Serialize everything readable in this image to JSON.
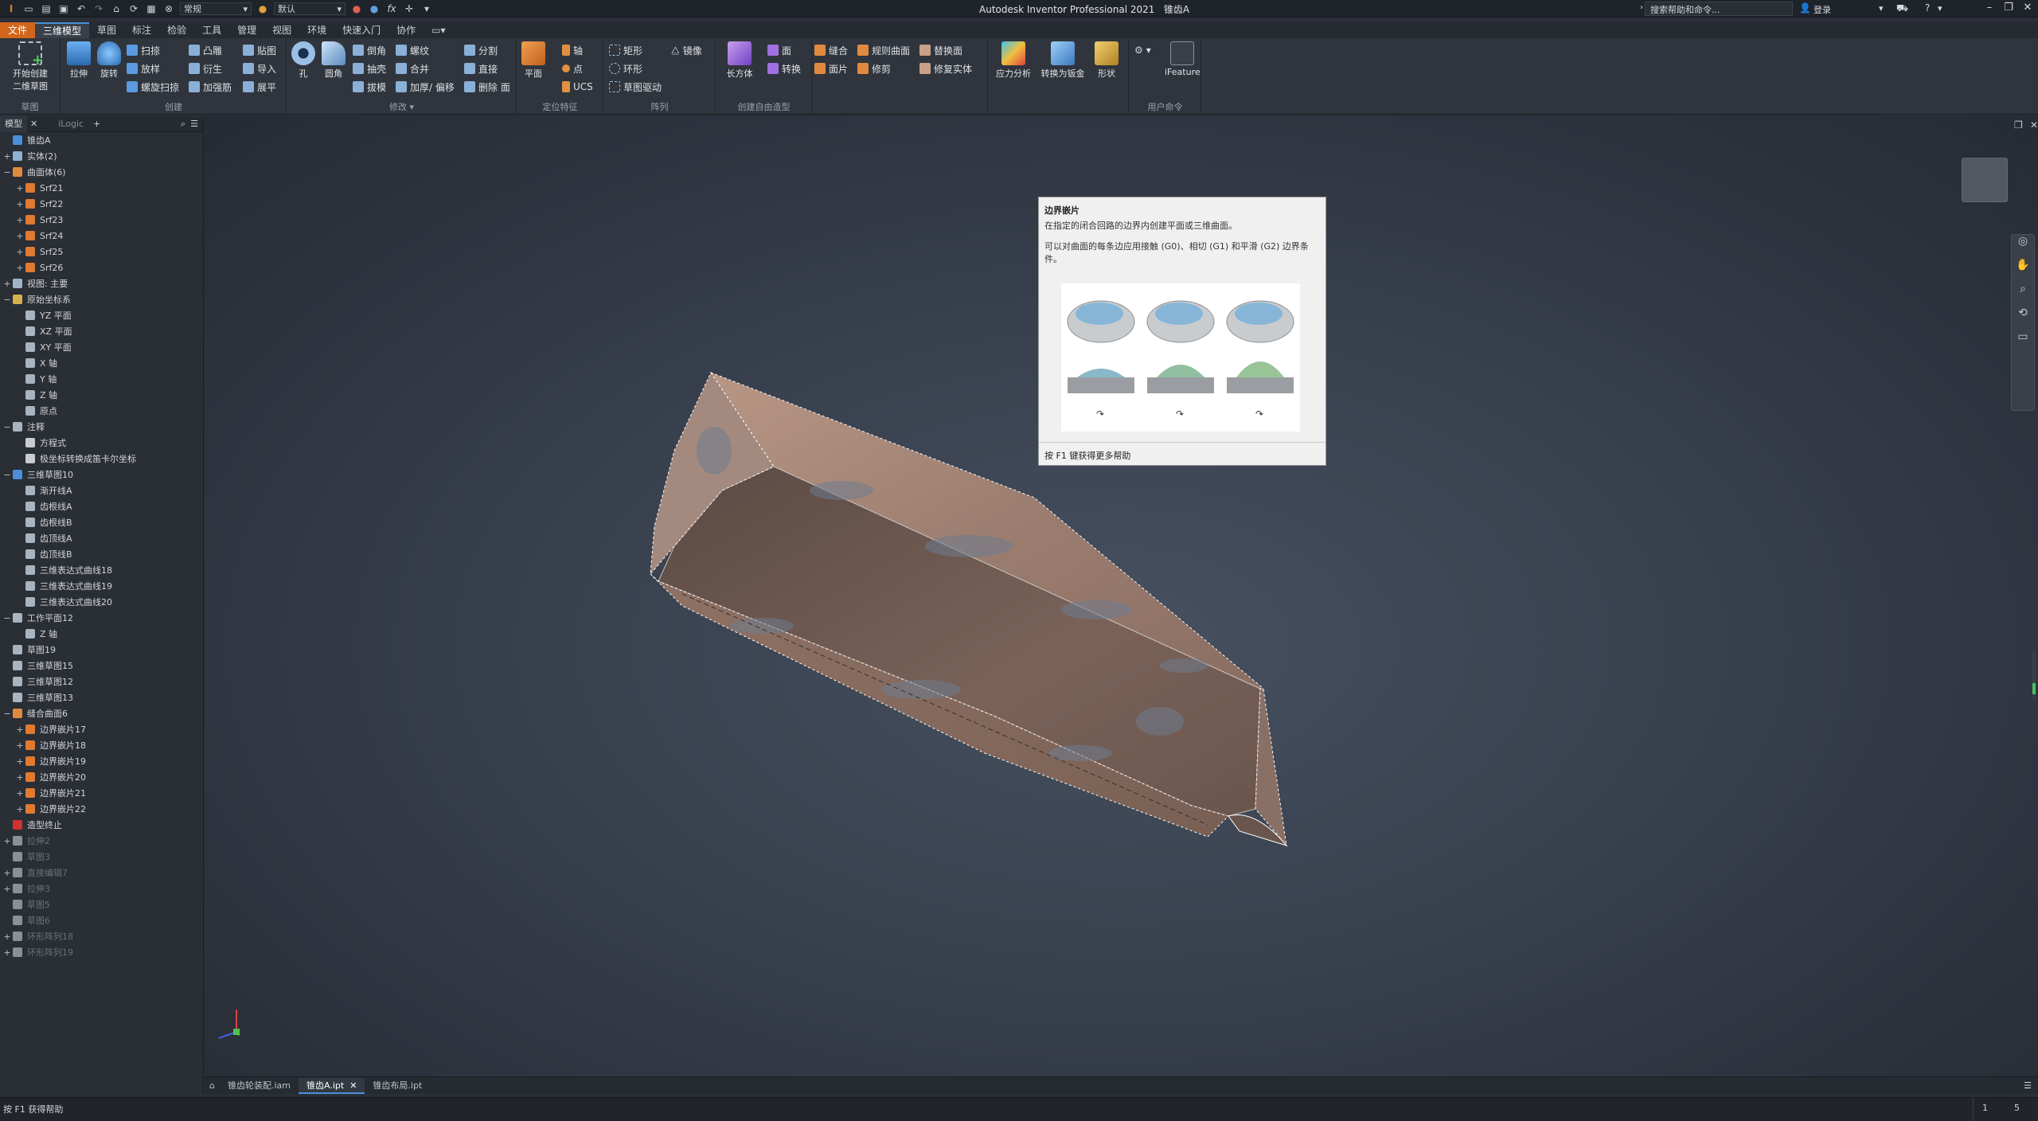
{
  "titlebar": {
    "style_value": "常规",
    "material_value": "默认",
    "fx_label": "fx",
    "app_title": "Autodesk Inventor Professional 2021",
    "doc_title": "锥齿A",
    "search_placeholder": "搜索帮助和命令...",
    "login_label": "登录"
  },
  "menu": {
    "tabs": [
      "文件",
      "三维模型",
      "草图",
      "标注",
      "检验",
      "工具",
      "管理",
      "视图",
      "环境",
      "快速入门",
      "协作"
    ]
  },
  "ribbon": {
    "sketch": {
      "start_label_1": "开始创建",
      "start_label_2": "二维草图",
      "panel": "草图"
    },
    "create": {
      "extrude": "拉伸",
      "revolve": "旋转",
      "sweep": "扫掠",
      "loft": "放样",
      "coil": "螺旋扫掠",
      "emboss": "凸雕",
      "derive": "衍生",
      "rib": "加强筋",
      "decal": "贴图",
      "import": "导入",
      "unwrap": "展平",
      "panel": "创建"
    },
    "modify": {
      "hole": "孔",
      "fillet": "圆角",
      "chamfer": "倒角",
      "shell": "抽壳",
      "draft": "拔模",
      "thread": "螺纹",
      "combine": "合并",
      "thicken": "加厚/ 偏移",
      "split": "分割",
      "direct": "直接",
      "delete_face": "删除 面",
      "panel": "修改 ▾"
    },
    "work": {
      "plane": "平面",
      "axis": "轴",
      "point": "点",
      "ucs": "UCS",
      "panel": "定位特征"
    },
    "pattern": {
      "rect": "矩形",
      "circ": "环形",
      "sketch_driven": "草图驱动",
      "mirror": "镜像",
      "panel": "阵列"
    },
    "freeform": {
      "box": "长方体",
      "face": "面",
      "convert": "转换",
      "panel": "创建自由造型"
    },
    "surface": {
      "stitch": "缝合",
      "ruled": "规则曲面",
      "patch": "面片",
      "trim": "修剪",
      "replace": "替换面",
      "repair": "修复实体"
    },
    "sim": {
      "stress": "应力分析",
      "convert_sm": "转换为钣金",
      "shape": "形状"
    },
    "user": {
      "ifeature": "iFeature",
      "panel": "用户命令"
    }
  },
  "browser": {
    "tab_model": "模型",
    "tab_ilogic": "iLogic",
    "tree": [
      {
        "label": "锥齿A",
        "level": 0,
        "tog": "",
        "icon": "#4a8fd8"
      },
      {
        "label": "实体(2)",
        "level": 0,
        "tog": "+",
        "icon": "#8fb0d0"
      },
      {
        "label": "曲面体(6)",
        "level": 0,
        "tog": "−",
        "icon": "#e08a40"
      },
      {
        "label": "Srf21",
        "level": 1,
        "tog": "+",
        "icon": "#e07a30"
      },
      {
        "label": "Srf22",
        "level": 1,
        "tog": "+",
        "icon": "#e07a30"
      },
      {
        "label": "Srf23",
        "level": 1,
        "tog": "+",
        "icon": "#e07a30"
      },
      {
        "label": "Srf24",
        "level": 1,
        "tog": "+",
        "icon": "#e07a30"
      },
      {
        "label": "Srf25",
        "level": 1,
        "tog": "+",
        "icon": "#e07a30"
      },
      {
        "label": "Srf26",
        "level": 1,
        "tog": "+",
        "icon": "#e07a30"
      },
      {
        "label": "视图: 主要",
        "level": 0,
        "tog": "+",
        "icon": "#a0b4c8"
      },
      {
        "label": "原始坐标系",
        "level": 0,
        "tog": "−",
        "icon": "#d6b050"
      },
      {
        "label": "YZ 平面",
        "level": 1,
        "tog": "",
        "icon": "#a8b4c0"
      },
      {
        "label": "XZ 平面",
        "level": 1,
        "tog": "",
        "icon": "#a8b4c0"
      },
      {
        "label": "XY 平面",
        "level": 1,
        "tog": "",
        "icon": "#a8b4c0"
      },
      {
        "label": "X 轴",
        "level": 1,
        "tog": "",
        "icon": "#a8b4c0"
      },
      {
        "label": "Y 轴",
        "level": 1,
        "tog": "",
        "icon": "#a8b4c0"
      },
      {
        "label": "Z 轴",
        "level": 1,
        "tog": "",
        "icon": "#a8b4c0"
      },
      {
        "label": "原点",
        "level": 1,
        "tog": "",
        "icon": "#a8b4c0"
      },
      {
        "label": "注释",
        "level": 0,
        "tog": "−",
        "icon": "#a8b4c0"
      },
      {
        "label": "方程式",
        "level": 1,
        "tog": "",
        "icon": "#c8ccd2"
      },
      {
        "label": "极坐标转换成笛卡尔坐标",
        "level": 1,
        "tog": "",
        "icon": "#c8ccd2"
      },
      {
        "label": "三维草图10",
        "level": 0,
        "tog": "−",
        "icon": "#4a8fd8"
      },
      {
        "label": "渐开线A",
        "level": 1,
        "tog": "",
        "icon": "#a8b4c0"
      },
      {
        "label": "齿根线A",
        "level": 1,
        "tog": "",
        "icon": "#a8b4c0"
      },
      {
        "label": "齿根线B",
        "level": 1,
        "tog": "",
        "icon": "#a8b4c0"
      },
      {
        "label": "齿顶线A",
        "level": 1,
        "tog": "",
        "icon": "#a8b4c0"
      },
      {
        "label": "齿顶线B",
        "level": 1,
        "tog": "",
        "icon": "#a8b4c0"
      },
      {
        "label": "三维表达式曲线18",
        "level": 1,
        "tog": "",
        "icon": "#a8b4c0"
      },
      {
        "label": "三维表达式曲线19",
        "level": 1,
        "tog": "",
        "icon": "#a8b4c0"
      },
      {
        "label": "三维表达式曲线20",
        "level": 1,
        "tog": "",
        "icon": "#a8b4c0"
      },
      {
        "label": "工作平面12",
        "level": 0,
        "tog": "−",
        "icon": "#a8b4c0"
      },
      {
        "label": "Z 轴",
        "level": 1,
        "tog": "",
        "icon": "#a8b4c0"
      },
      {
        "label": "草图19",
        "level": 0,
        "tog": "",
        "icon": "#a8b4c0"
      },
      {
        "label": "三维草图15",
        "level": 0,
        "tog": "",
        "icon": "#a8b4c0"
      },
      {
        "label": "三维草图12",
        "level": 0,
        "tog": "",
        "icon": "#a8b4c0"
      },
      {
        "label": "三维草图13",
        "level": 0,
        "tog": "",
        "icon": "#a8b4c0"
      },
      {
        "label": "缝合曲面6",
        "level": 0,
        "tog": "−",
        "icon": "#e08a40"
      },
      {
        "label": "边界嵌片17",
        "level": 1,
        "tog": "+",
        "icon": "#e07a30"
      },
      {
        "label": "边界嵌片18",
        "level": 1,
        "tog": "+",
        "icon": "#e07a30"
      },
      {
        "label": "边界嵌片19",
        "level": 1,
        "tog": "+",
        "icon": "#e07a30"
      },
      {
        "label": "边界嵌片20",
        "level": 1,
        "tog": "+",
        "icon": "#e07a30"
      },
      {
        "label": "边界嵌片21",
        "level": 1,
        "tog": "+",
        "icon": "#e07a30"
      },
      {
        "label": "边界嵌片22",
        "level": 1,
        "tog": "+",
        "icon": "#e07a30"
      },
      {
        "label": "造型终止",
        "level": 0,
        "tog": "",
        "icon": "#d03030"
      },
      {
        "label": "拉伸2",
        "level": 0,
        "tog": "+",
        "icon": "#8a9098",
        "dim": true
      },
      {
        "label": "草图3",
        "level": 0,
        "tog": "",
        "icon": "#8a9098",
        "dim": true
      },
      {
        "label": "直接编辑7",
        "level": 0,
        "tog": "+",
        "icon": "#8a9098",
        "dim": true
      },
      {
        "label": "拉伸3",
        "level": 0,
        "tog": "+",
        "icon": "#8a9098",
        "dim": true
      },
      {
        "label": "草图5",
        "level": 0,
        "tog": "",
        "icon": "#8a9098",
        "dim": true
      },
      {
        "label": "草图6",
        "level": 0,
        "tog": "",
        "icon": "#8a9098",
        "dim": true
      },
      {
        "label": "环形阵列18",
        "level": 0,
        "tog": "+",
        "icon": "#8a9098",
        "dim": true
      },
      {
        "label": "环形阵列19",
        "level": 0,
        "tog": "+",
        "icon": "#8a9098",
        "dim": true
      }
    ]
  },
  "tooltip": {
    "title": "边界嵌片",
    "desc1": "在指定的闭合回路的边界内创建平面或三维曲面。",
    "desc2": "可以对曲面的每条边应用接触 (G0)、相切 (G1) 和平滑 (G2) 边界条件。",
    "footer": "按 F1 键获得更多帮助"
  },
  "doctabs": [
    "锥齿轮装配.iam",
    "锥齿A.ipt",
    "锥齿布局.ipt"
  ],
  "status": {
    "help": "按 F1 获得帮助",
    "num1": "1",
    "num2": "5"
  },
  "colors": {
    "accent": "#4a8fd8",
    "file_tab": "#d2661c",
    "surface": "#a88a78"
  }
}
